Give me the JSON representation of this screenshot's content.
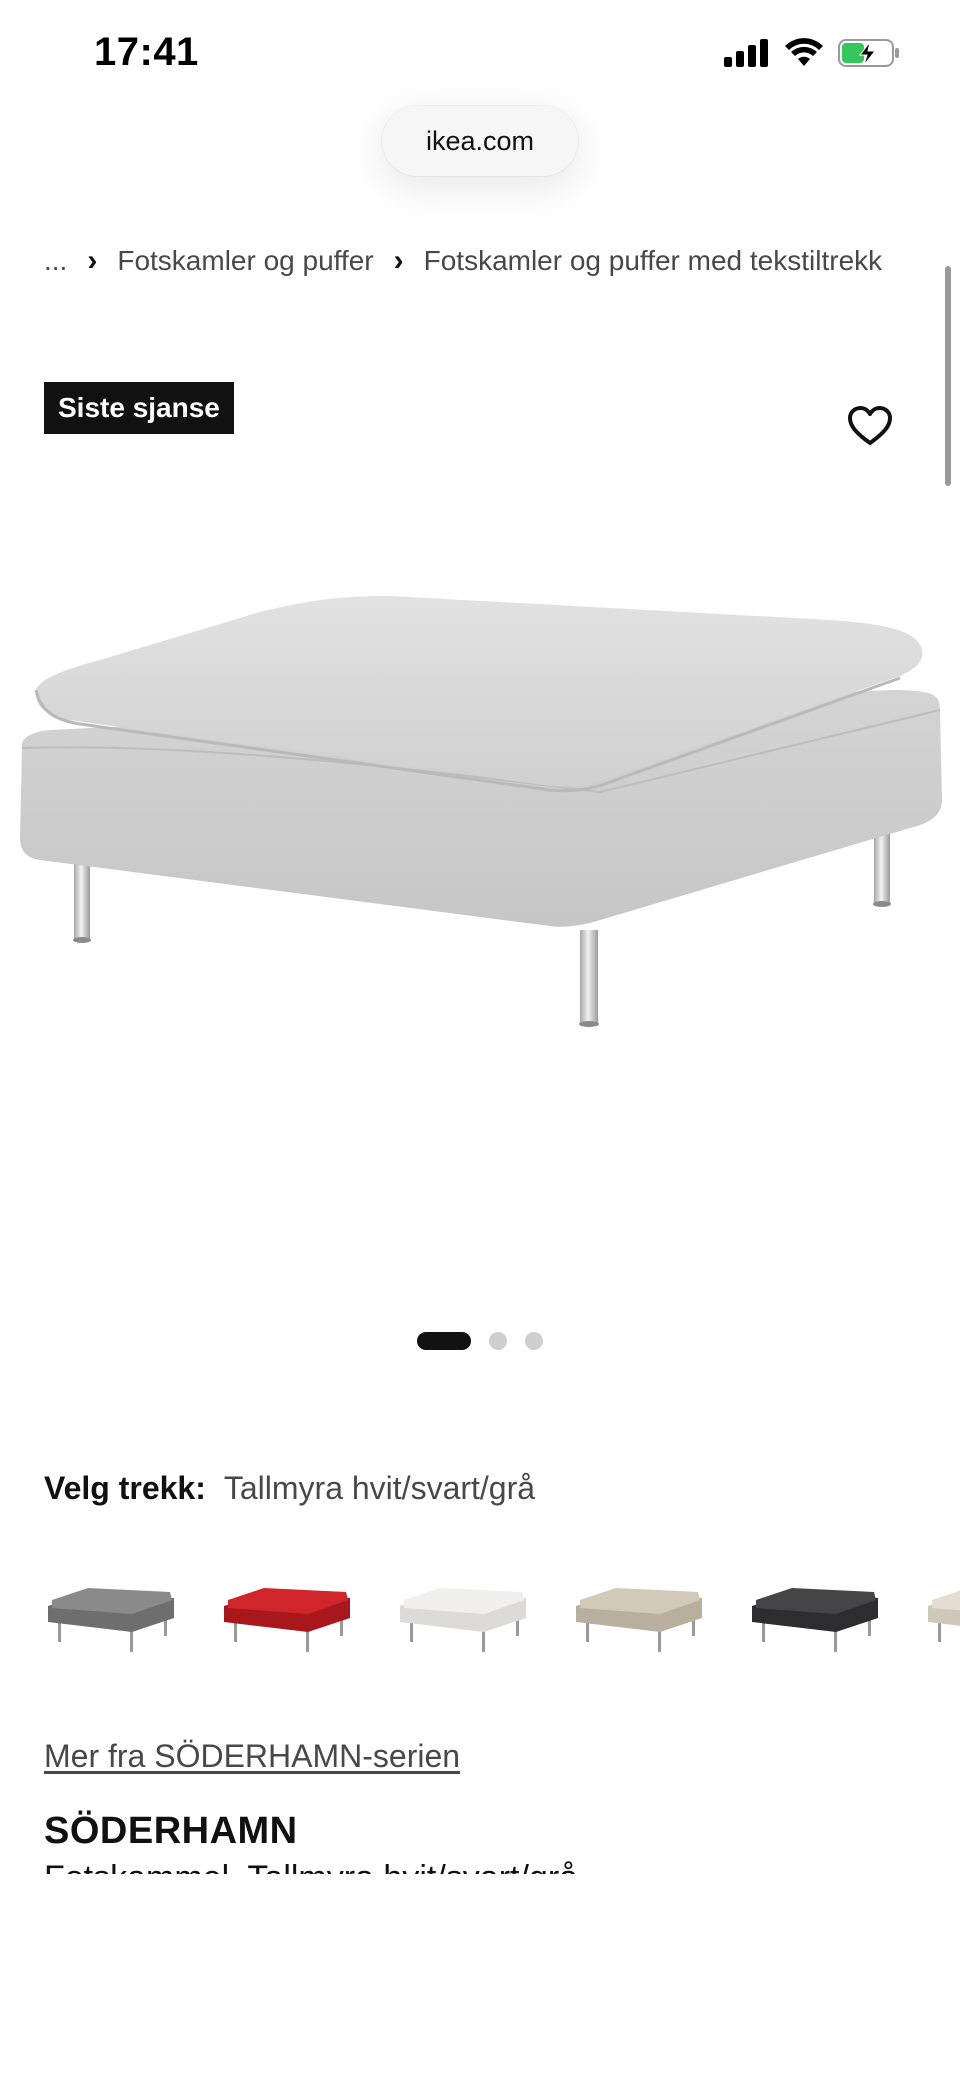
{
  "status_bar": {
    "time": "17:41",
    "icons": [
      "signal-icon",
      "wifi-icon",
      "battery-charging-icon"
    ]
  },
  "browser": {
    "url": "ikea.com"
  },
  "breadcrumb": {
    "ellipsis": "...",
    "items": [
      "Fotskamler og puffer",
      "Fotskamler og puffer med tekstiltrekk"
    ]
  },
  "product": {
    "badge": "Siste sjanse",
    "favorite_icon": "heart-outline-icon",
    "image_count": 3,
    "active_image": 1,
    "variant_label": "Velg trekk:",
    "variant_value": "Tallmyra hvit/svart/grå",
    "swatches": [
      {
        "name": "grey",
        "color": "#7a7a7a"
      },
      {
        "name": "red",
        "color": "#c41e24"
      },
      {
        "name": "white",
        "color": "#ecebe8"
      },
      {
        "name": "beige",
        "color": "#c9c0b0"
      },
      {
        "name": "dark-grey",
        "color": "#3a3a3c"
      },
      {
        "name": "light-beige",
        "color": "#ddd6c8"
      }
    ],
    "series_link": "Mer fra SÖDERHAMN-serien",
    "name": "SÖDERHAMN",
    "description": "Fotskammel, Tallmyra hvit/svart/grå"
  },
  "colors": {
    "accent": "#111111",
    "fabric": "#d9d9d9"
  }
}
